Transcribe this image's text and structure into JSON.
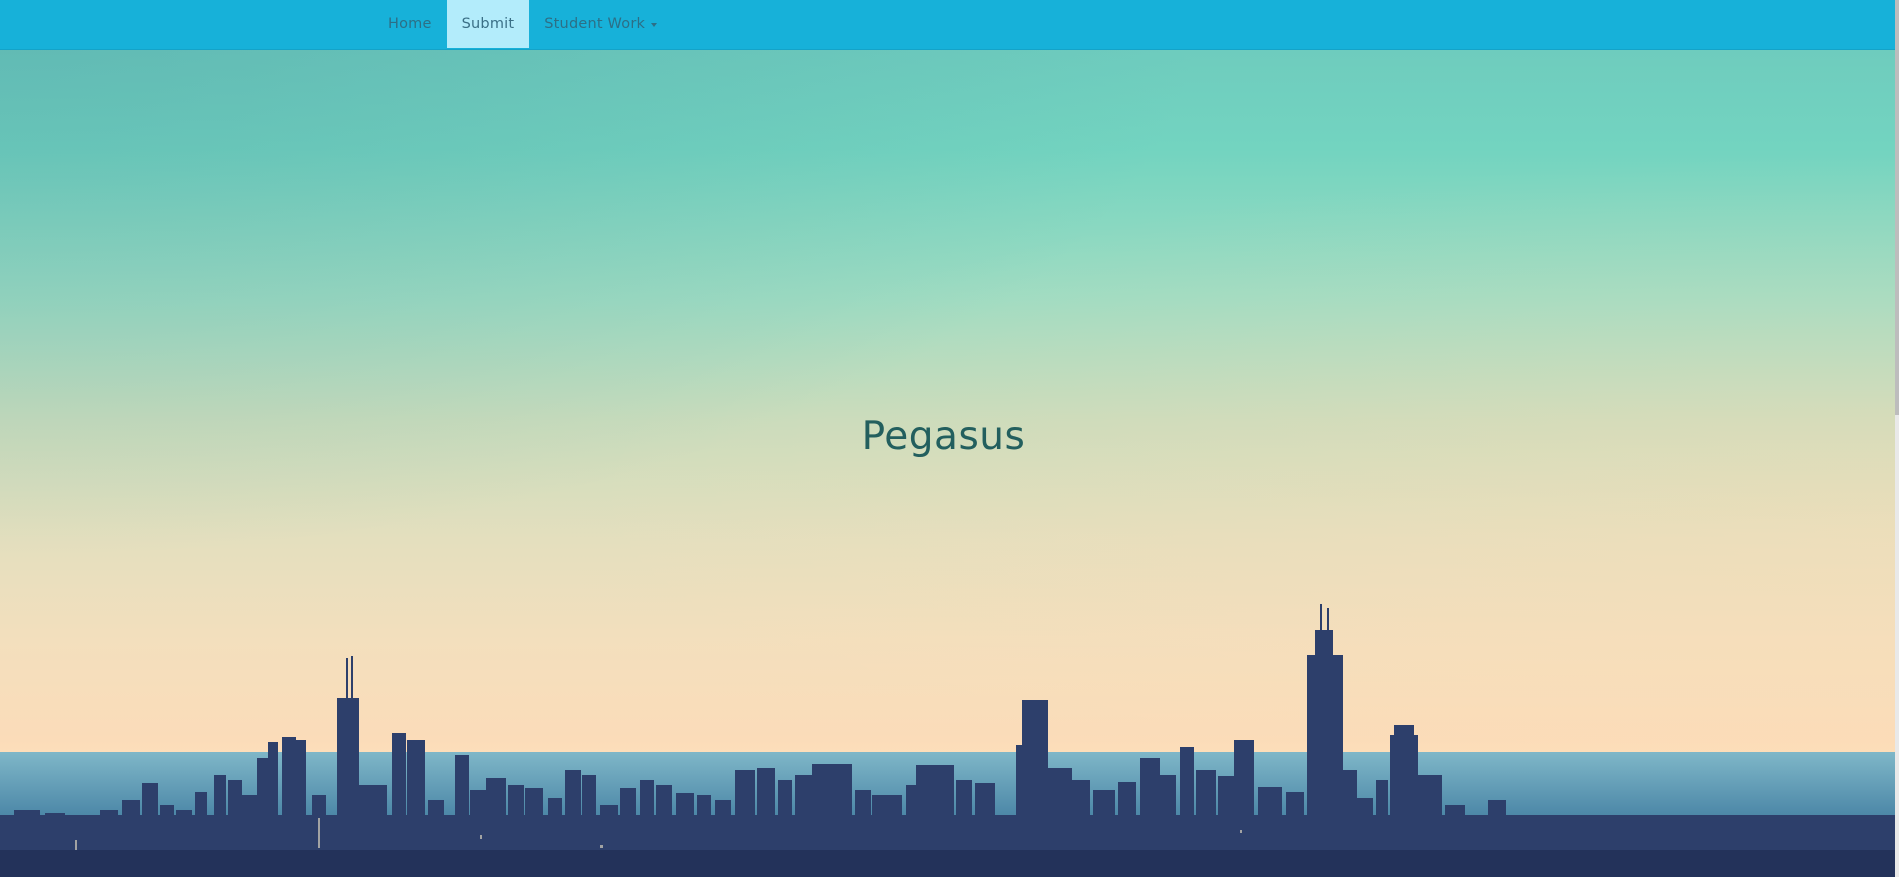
{
  "navbar": {
    "items": [
      {
        "label": "Home",
        "active": false
      },
      {
        "label": "Submit",
        "active": true
      },
      {
        "label": "Student Work",
        "active": false,
        "dropdown": true
      }
    ],
    "background_color": "#17b1d9",
    "active_color": "#b3ecfb"
  },
  "hero": {
    "title": "Pegasus",
    "background_image": "city-skyline-at-dusk"
  }
}
